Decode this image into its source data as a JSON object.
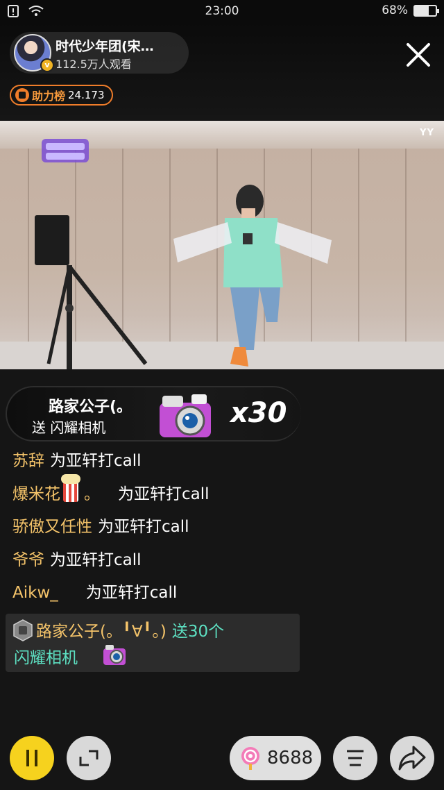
{
  "status_bar": {
    "time": "23:00",
    "battery_percent": "68%",
    "battery_level": 0.68,
    "icons": [
      "notification-icon",
      "wifi-icon",
      "battery-icon"
    ]
  },
  "header": {
    "host_name": "时代少年团(宋…",
    "viewers": "112.5万人观看",
    "support_label": "助力榜",
    "support_count": "24.173",
    "close_icon": "close-icon"
  },
  "video": {
    "watermark": "YY",
    "logo_icon": "show-logo"
  },
  "gift_banner": {
    "sender": "路家公子(。",
    "action": "送 闪耀相机",
    "count": "x30",
    "gift_icon": "camera-gift-icon"
  },
  "chat": [
    {
      "user": "苏辞",
      "message": "为亚轩打call",
      "emoji": ""
    },
    {
      "user": "爆米花",
      "message": "为亚轩打call",
      "emoji": "popcorn-icon",
      "suffix": "。"
    },
    {
      "user": "骄傲又任性",
      "message": "为亚轩打call",
      "emoji": ""
    },
    {
      "user": "爷爷",
      "message": "为亚轩打call",
      "emoji": ""
    },
    {
      "user": "Aikw_",
      "message": "为亚轩打call",
      "emoji": ""
    }
  ],
  "gift_notice": {
    "user": "路家公子(。╹∀╹。)",
    "action": "送30个",
    "gift": "闪耀相机",
    "level_badge": "level-badge-icon"
  },
  "bottom_bar": {
    "coins": "8688",
    "pause_icon": "pause-icon",
    "fullscreen_icon": "fullscreen-icon",
    "candy_icon": "candy-icon",
    "menu_icon": "menu-icon",
    "share_icon": "share-icon"
  },
  "colors": {
    "background": "#151515",
    "username": "#f5c46a",
    "gift_text": "#5de0c2",
    "support_accent": "#f07d2a",
    "pause_button": "#f6d21e"
  }
}
